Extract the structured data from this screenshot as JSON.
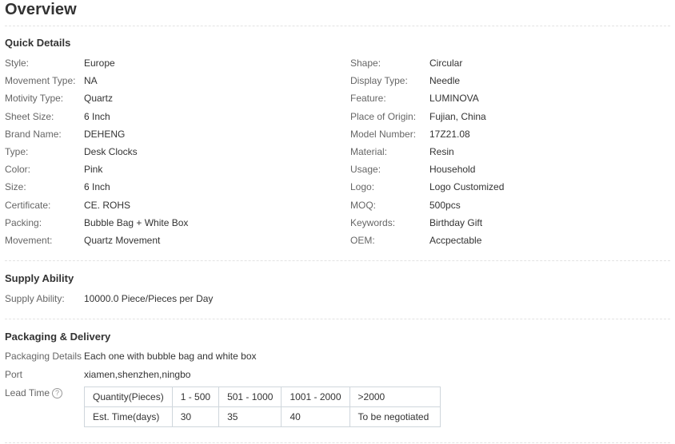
{
  "title": "Overview",
  "quick_details": {
    "heading": "Quick Details",
    "left": [
      {
        "label": "Style:",
        "value": "Europe"
      },
      {
        "label": "Movement Type:",
        "value": "NA"
      },
      {
        "label": "Motivity Type:",
        "value": "Quartz"
      },
      {
        "label": "Sheet Size:",
        "value": "6 Inch"
      },
      {
        "label": "Brand Name:",
        "value": "DEHENG"
      },
      {
        "label": "Type:",
        "value": "Desk Clocks"
      },
      {
        "label": "Color:",
        "value": "Pink"
      },
      {
        "label": "Size:",
        "value": "6 Inch"
      },
      {
        "label": "Certificate:",
        "value": "CE. ROHS"
      },
      {
        "label": "Packing:",
        "value": "Bubble Bag + White Box"
      },
      {
        "label": "Movement:",
        "value": "Quartz Movement"
      }
    ],
    "right": [
      {
        "label": "Shape:",
        "value": "Circular"
      },
      {
        "label": "Display Type:",
        "value": "Needle"
      },
      {
        "label": "Feature:",
        "value": "LUMINOVA"
      },
      {
        "label": "Place of Origin:",
        "value": "Fujian, China"
      },
      {
        "label": "Model Number:",
        "value": "17Z21.08"
      },
      {
        "label": "Material:",
        "value": "Resin"
      },
      {
        "label": "Usage:",
        "value": "Household"
      },
      {
        "label": "Logo:",
        "value": "Logo Customized"
      },
      {
        "label": "MOQ:",
        "value": "500pcs"
      },
      {
        "label": "Keywords:",
        "value": "Birthday Gift"
      },
      {
        "label": "OEM:",
        "value": "Accpectable"
      }
    ]
  },
  "supply_ability": {
    "heading": "Supply Ability",
    "label": "Supply Ability:",
    "value": "10000.0 Piece/Pieces per Day"
  },
  "packaging": {
    "heading": "Packaging & Delivery",
    "details_label": "Packaging Details",
    "details_value": "Each one with bubble bag and white box",
    "port_label": "Port",
    "port_value": "xiamen,shenzhen,ningbo",
    "lead_time_label": "Lead Time",
    "help_icon": "question-circle-icon",
    "lead_time_table": {
      "header": [
        "Quantity(Pieces)",
        "1 - 500",
        "501 - 1000",
        "1001 - 2000",
        ">2000"
      ],
      "row": [
        "Est. Time(days)",
        "30",
        "35",
        "40",
        "To be negotiated"
      ]
    }
  }
}
